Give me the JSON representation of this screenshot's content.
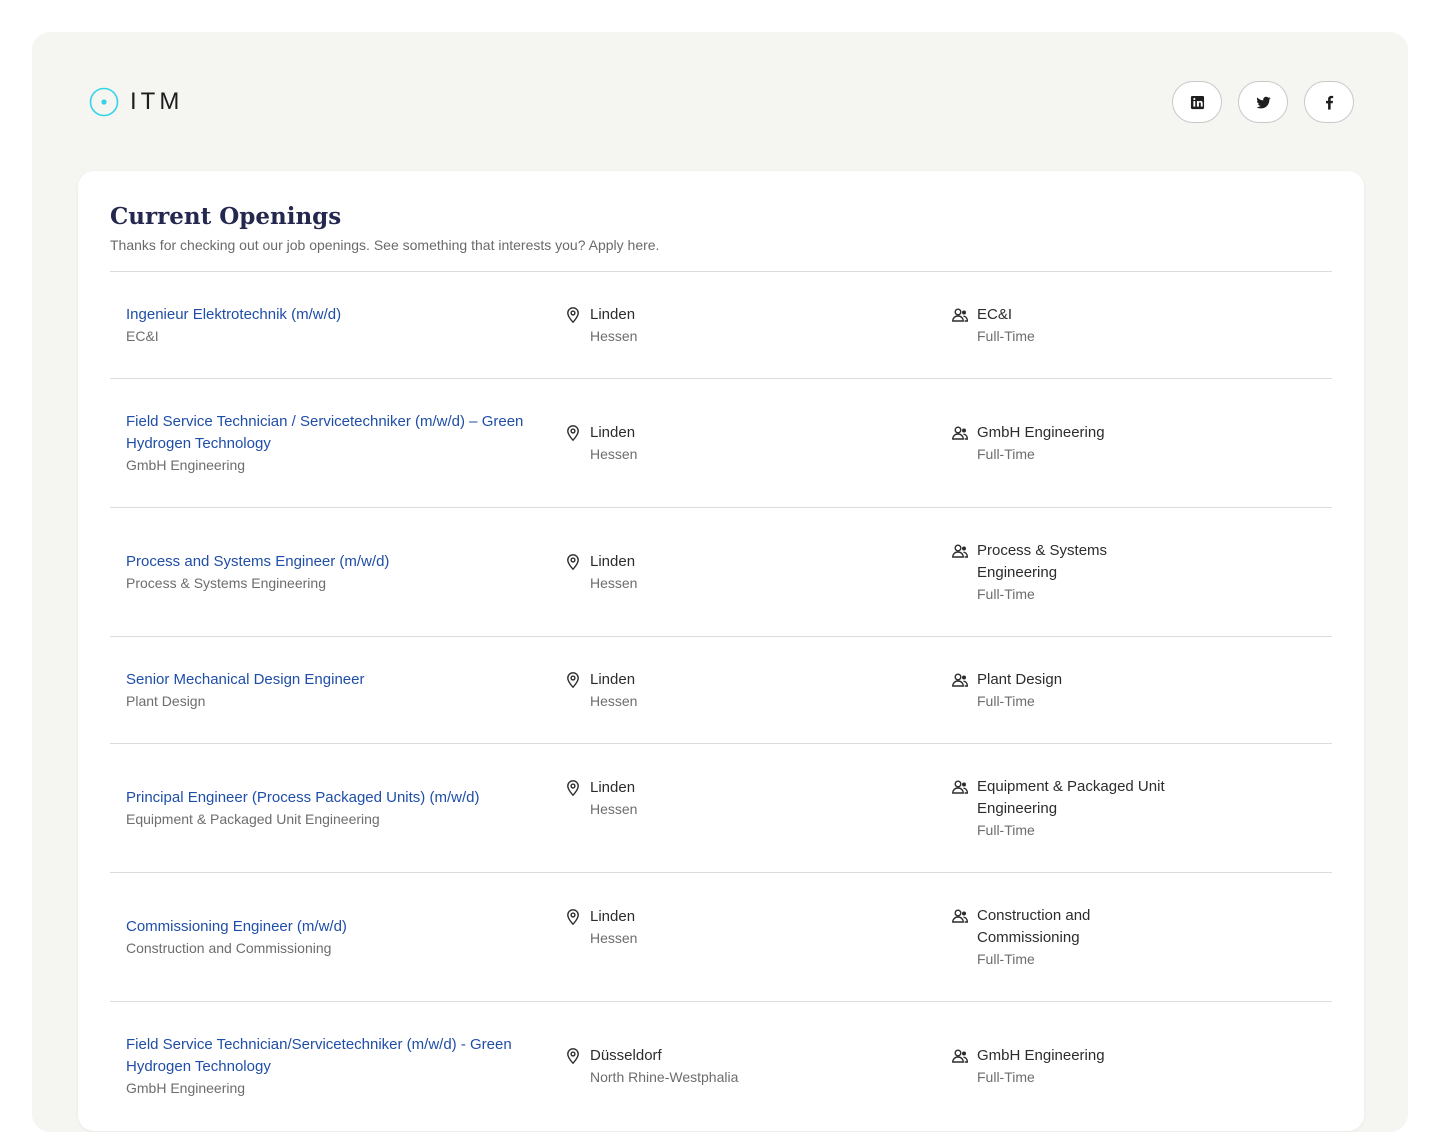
{
  "header": {
    "logo_text": "ITM",
    "accent_color": "#35d3e6",
    "socials": [
      {
        "icon": "linkedin-icon"
      },
      {
        "icon": "twitter-icon"
      },
      {
        "icon": "facebook-icon"
      }
    ]
  },
  "openings": {
    "title": "Current Openings",
    "subtitle": "Thanks for checking out our job openings. See something that interests you? Apply here.",
    "jobs": [
      {
        "title": "Ingenieur Elektrotechnik (m/w/d)",
        "department": "EC&I",
        "city": "Linden",
        "region": "Hessen",
        "team": "EC&I",
        "type": "Full-Time"
      },
      {
        "title": "Field Service Technician / Servicetechniker (m/w/d) – Green Hydrogen Technology",
        "department": "GmbH Engineering",
        "city": "Linden",
        "region": "Hessen",
        "team": "GmbH Engineering",
        "type": "Full-Time"
      },
      {
        "title": "Process and Systems Engineer (m/w/d)",
        "department": "Process & Systems Engineering",
        "city": "Linden",
        "region": "Hessen",
        "team": "Process & Systems Engineering",
        "type": "Full-Time"
      },
      {
        "title": "Senior Mechanical Design Engineer",
        "department": "Plant Design",
        "city": "Linden",
        "region": "Hessen",
        "team": "Plant Design",
        "type": "Full-Time"
      },
      {
        "title": "Principal Engineer (Process Packaged Units) (m/w/d)",
        "department": "Equipment & Packaged Unit Engineering",
        "city": "Linden",
        "region": "Hessen",
        "team": "Equipment & Packaged Unit Engineering",
        "type": "Full-Time"
      },
      {
        "title": "Commissioning Engineer (m/w/d)",
        "department": "Construction and Commissioning",
        "city": "Linden",
        "region": "Hessen",
        "team": "Construction and Commissioning",
        "type": "Full-Time"
      },
      {
        "title": "Field Service Technician/Servicetechniker (m/w/d) - Green Hydrogen Technology",
        "department": "GmbH Engineering",
        "city": "Düsseldorf",
        "region": "North Rhine-Westphalia",
        "team": "GmbH Engineering",
        "type": "Full-Time"
      }
    ]
  }
}
